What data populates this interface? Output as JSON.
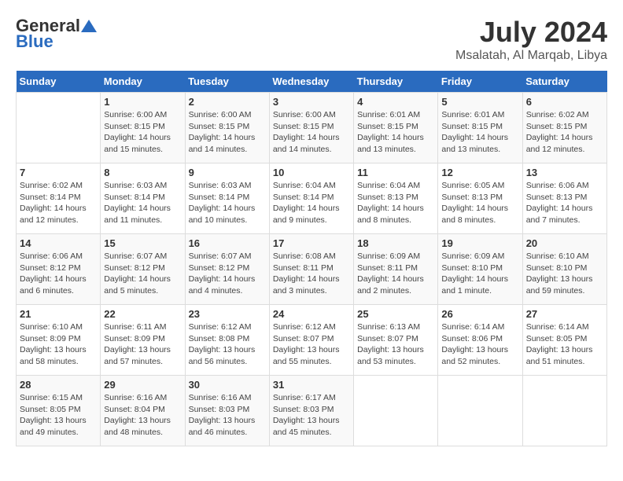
{
  "logo": {
    "general": "General",
    "blue": "Blue"
  },
  "header": {
    "month_year": "July 2024",
    "location": "Msalatah, Al Marqab, Libya"
  },
  "weekdays": [
    "Sunday",
    "Monday",
    "Tuesday",
    "Wednesday",
    "Thursday",
    "Friday",
    "Saturday"
  ],
  "weeks": [
    [
      {
        "day": "",
        "info": ""
      },
      {
        "day": "1",
        "info": "Sunrise: 6:00 AM\nSunset: 8:15 PM\nDaylight: 14 hours\nand 15 minutes."
      },
      {
        "day": "2",
        "info": "Sunrise: 6:00 AM\nSunset: 8:15 PM\nDaylight: 14 hours\nand 14 minutes."
      },
      {
        "day": "3",
        "info": "Sunrise: 6:00 AM\nSunset: 8:15 PM\nDaylight: 14 hours\nand 14 minutes."
      },
      {
        "day": "4",
        "info": "Sunrise: 6:01 AM\nSunset: 8:15 PM\nDaylight: 14 hours\nand 13 minutes."
      },
      {
        "day": "5",
        "info": "Sunrise: 6:01 AM\nSunset: 8:15 PM\nDaylight: 14 hours\nand 13 minutes."
      },
      {
        "day": "6",
        "info": "Sunrise: 6:02 AM\nSunset: 8:15 PM\nDaylight: 14 hours\nand 12 minutes."
      }
    ],
    [
      {
        "day": "7",
        "info": "Sunrise: 6:02 AM\nSunset: 8:14 PM\nDaylight: 14 hours\nand 12 minutes."
      },
      {
        "day": "8",
        "info": "Sunrise: 6:03 AM\nSunset: 8:14 PM\nDaylight: 14 hours\nand 11 minutes."
      },
      {
        "day": "9",
        "info": "Sunrise: 6:03 AM\nSunset: 8:14 PM\nDaylight: 14 hours\nand 10 minutes."
      },
      {
        "day": "10",
        "info": "Sunrise: 6:04 AM\nSunset: 8:14 PM\nDaylight: 14 hours\nand 9 minutes."
      },
      {
        "day": "11",
        "info": "Sunrise: 6:04 AM\nSunset: 8:13 PM\nDaylight: 14 hours\nand 8 minutes."
      },
      {
        "day": "12",
        "info": "Sunrise: 6:05 AM\nSunset: 8:13 PM\nDaylight: 14 hours\nand 8 minutes."
      },
      {
        "day": "13",
        "info": "Sunrise: 6:06 AM\nSunset: 8:13 PM\nDaylight: 14 hours\nand 7 minutes."
      }
    ],
    [
      {
        "day": "14",
        "info": "Sunrise: 6:06 AM\nSunset: 8:12 PM\nDaylight: 14 hours\nand 6 minutes."
      },
      {
        "day": "15",
        "info": "Sunrise: 6:07 AM\nSunset: 8:12 PM\nDaylight: 14 hours\nand 5 minutes."
      },
      {
        "day": "16",
        "info": "Sunrise: 6:07 AM\nSunset: 8:12 PM\nDaylight: 14 hours\nand 4 minutes."
      },
      {
        "day": "17",
        "info": "Sunrise: 6:08 AM\nSunset: 8:11 PM\nDaylight: 14 hours\nand 3 minutes."
      },
      {
        "day": "18",
        "info": "Sunrise: 6:09 AM\nSunset: 8:11 PM\nDaylight: 14 hours\nand 2 minutes."
      },
      {
        "day": "19",
        "info": "Sunrise: 6:09 AM\nSunset: 8:10 PM\nDaylight: 14 hours\nand 1 minute."
      },
      {
        "day": "20",
        "info": "Sunrise: 6:10 AM\nSunset: 8:10 PM\nDaylight: 13 hours\nand 59 minutes."
      }
    ],
    [
      {
        "day": "21",
        "info": "Sunrise: 6:10 AM\nSunset: 8:09 PM\nDaylight: 13 hours\nand 58 minutes."
      },
      {
        "day": "22",
        "info": "Sunrise: 6:11 AM\nSunset: 8:09 PM\nDaylight: 13 hours\nand 57 minutes."
      },
      {
        "day": "23",
        "info": "Sunrise: 6:12 AM\nSunset: 8:08 PM\nDaylight: 13 hours\nand 56 minutes."
      },
      {
        "day": "24",
        "info": "Sunrise: 6:12 AM\nSunset: 8:07 PM\nDaylight: 13 hours\nand 55 minutes."
      },
      {
        "day": "25",
        "info": "Sunrise: 6:13 AM\nSunset: 8:07 PM\nDaylight: 13 hours\nand 53 minutes."
      },
      {
        "day": "26",
        "info": "Sunrise: 6:14 AM\nSunset: 8:06 PM\nDaylight: 13 hours\nand 52 minutes."
      },
      {
        "day": "27",
        "info": "Sunrise: 6:14 AM\nSunset: 8:05 PM\nDaylight: 13 hours\nand 51 minutes."
      }
    ],
    [
      {
        "day": "28",
        "info": "Sunrise: 6:15 AM\nSunset: 8:05 PM\nDaylight: 13 hours\nand 49 minutes."
      },
      {
        "day": "29",
        "info": "Sunrise: 6:16 AM\nSunset: 8:04 PM\nDaylight: 13 hours\nand 48 minutes."
      },
      {
        "day": "30",
        "info": "Sunrise: 6:16 AM\nSunset: 8:03 PM\nDaylight: 13 hours\nand 46 minutes."
      },
      {
        "day": "31",
        "info": "Sunrise: 6:17 AM\nSunset: 8:03 PM\nDaylight: 13 hours\nand 45 minutes."
      },
      {
        "day": "",
        "info": ""
      },
      {
        "day": "",
        "info": ""
      },
      {
        "day": "",
        "info": ""
      }
    ]
  ]
}
